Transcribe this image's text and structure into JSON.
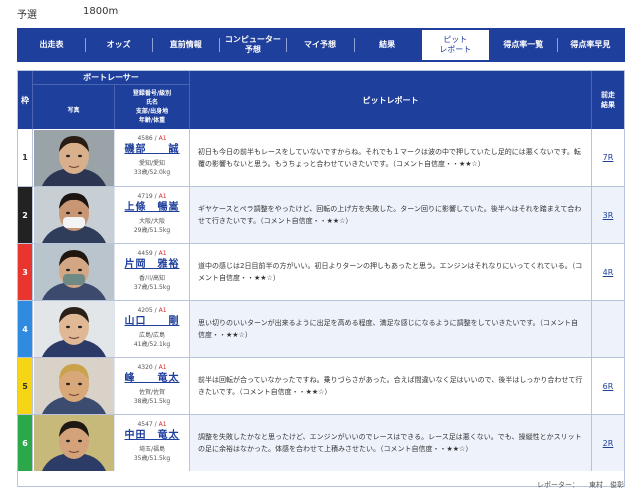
{
  "race": {
    "label": "予選",
    "distance": "1800m"
  },
  "nav": [
    {
      "label": "出走表",
      "active": false
    },
    {
      "label": "オッズ",
      "active": false
    },
    {
      "label": "直前情報",
      "active": false
    },
    {
      "label": "コンピューター\n予想",
      "active": false
    },
    {
      "label": "マイ予想",
      "active": false
    },
    {
      "label": "結果",
      "active": false
    },
    {
      "label": "ピット\nレポート",
      "active": true
    },
    {
      "label": "得点率一覧",
      "active": false
    },
    {
      "label": "得点率早見",
      "active": false
    }
  ],
  "table": {
    "header": {
      "waku": "枠",
      "racer": "ボートレーサー",
      "photo": "写真",
      "info_lines": [
        "登録番号/級別",
        "氏名",
        "支部/出身地",
        "年齢/体重"
      ],
      "report": "ピットレポート",
      "prev_lines": [
        "前走",
        "結果"
      ]
    },
    "rows": [
      {
        "waku": "1",
        "waku_bg": "#ffffff",
        "waku_fg": "#333333",
        "reg_no": "4586",
        "class": "A1",
        "name": "磯部　　誠",
        "branch": "愛知/愛知",
        "age_weight": "33歳/52.0kg",
        "report": "初日も今日の前半もレースをしていないですからね。それでも１マークは波の中で押していたし足的には悪くないです。転覆の影響もないと思う。もうちょっと合わせていきたいです。（コメント自信度・・★★☆）",
        "prev": "7R"
      },
      {
        "waku": "2",
        "waku_bg": "#222222",
        "waku_fg": "#ffffff",
        "reg_no": "4719",
        "class": "A1",
        "name": "上條　暢嵩",
        "branch": "大阪/大阪",
        "age_weight": "29歳/51.5kg",
        "report": "ギヤケースとペラ調整をやったけど、回転の上げ方を失敗した。ターン回りに影響していた。後半へはそれを踏まえて合わせて行きたいです。（コメント自信度・・★★☆）",
        "prev": "3R"
      },
      {
        "waku": "3",
        "waku_bg": "#e8352f",
        "waku_fg": "#ffffff",
        "reg_no": "4459",
        "class": "A1",
        "name": "片岡　雅裕",
        "branch": "香川/高知",
        "age_weight": "37歳/51.5kg",
        "report": "道中の感じは2日目前半の方がいい。初日よりターンの押しもあったと思う。エンジンはそれなりにいってくれている。（コメント自信度・・★★☆）",
        "prev": "4R"
      },
      {
        "waku": "4",
        "waku_bg": "#2f8be0",
        "waku_fg": "#ffffff",
        "reg_no": "4205",
        "class": "A1",
        "name": "山口　　剛",
        "branch": "広島/広島",
        "age_weight": "41歳/52.1kg",
        "report": "思い切りのいいターンが出来るように出足を高める程度、満足な感じになるように調整をしていきたいです。（コメント自信度・・★★☆）",
        "prev": ""
      },
      {
        "waku": "5",
        "waku_bg": "#f5d516",
        "waku_fg": "#333333",
        "reg_no": "4320",
        "class": "A1",
        "name": "峰　　竜太",
        "branch": "佐賀/佐賀",
        "age_weight": "38歳/51.5kg",
        "report": "前半は回転が合っていなかったですね。乗りづらさがあった。合えば間違いなく足はいいので、後半はしっかり合わせて行きたいです。（コメント自信度・・★★☆）",
        "prev": "6R"
      },
      {
        "waku": "6",
        "waku_bg": "#2aa84a",
        "waku_fg": "#ffffff",
        "reg_no": "4547",
        "class": "A1",
        "name": "中田　竜太",
        "branch": "埼玉/福島",
        "age_weight": "35歳/51.5kg",
        "report": "調整を失敗したかなと思ったけど、エンジンがいいのでレースはできる。レース足は悪くない。でも、操縦性とかスリットの足に余裕はなかった。体感を合わせて上積みさせたい。（コメント自信度・・★★☆）",
        "prev": "2R"
      }
    ]
  },
  "reporter": {
    "label": "レポーター：",
    "name": "東村　俊彰"
  },
  "colors": {
    "nav_bg": "#1f3f9c",
    "link": "#1f3f9c",
    "class_color": "#d42a2a",
    "alt_row": "#eef3fb"
  }
}
